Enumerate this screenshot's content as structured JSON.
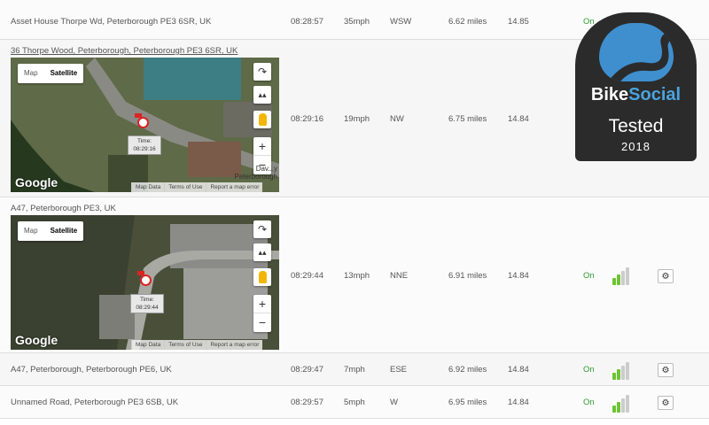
{
  "rows": [
    {
      "address": "Asset House Thorpe Wd, Peterborough PE3 6SR, UK",
      "time": "08:28:57",
      "speed": "35mph",
      "direction": "WSW",
      "distance": "6.62 miles",
      "voltage": "14.85",
      "ignition": "On"
    },
    {
      "address": "36 Thorpe Wood, Peterborough, Peterborough PE3 6SR, UK",
      "time": "08:29:16",
      "speed": "19mph",
      "direction": "NW",
      "distance": "6.75 miles",
      "voltage": "14.84"
    },
    {
      "address": "A47, Peterborough PE3, UK",
      "time": "08:29:44",
      "speed": "13mph",
      "direction": "NNE",
      "distance": "6.91 miles",
      "voltage": "14.84",
      "ignition": "On",
      "signal_bars": 2
    },
    {
      "address": "A47, Peterborough, Peterborough PE6, UK",
      "time": "08:29:47",
      "speed": "7mph",
      "direction": "ESE",
      "distance": "6.92 miles",
      "voltage": "14.84",
      "ignition": "On",
      "signal_bars": 2
    },
    {
      "address": "Unnamed Road, Peterborough PE3 6SB, UK",
      "time": "08:29:57",
      "speed": "5mph",
      "direction": "W",
      "distance": "6.95 miles",
      "voltage": "14.84",
      "ignition": "On",
      "signal_bars": 2
    }
  ],
  "maps": [
    {
      "toggle_map": "Map",
      "toggle_satellite": "Satellite",
      "tip_label": "Time:",
      "tip_time": "08:29:16",
      "google": "Google",
      "attrib": [
        "Map Data",
        "Terms of Use",
        "Report a map error"
      ],
      "place_line1": "Dav...y",
      "place_line2": "Peterborough"
    },
    {
      "toggle_map": "Map",
      "toggle_satellite": "Satellite",
      "tip_label": "Time:",
      "tip_time": "08:29:44",
      "google": "Google",
      "attrib": [
        "Map Data",
        "Terms of Use",
        "Report a map error"
      ]
    }
  ],
  "badge": {
    "brand_a": "Bike",
    "brand_b": "Social",
    "tested": "Tested",
    "year": "2018"
  },
  "icons": {
    "gear": "gear-icon",
    "signal": "signal-strength-icon",
    "rotate": "rotate-map-icon",
    "tilt": "tilt-icon",
    "pegman": "street-view-icon"
  },
  "colors": {
    "ignition_on": "#2f9a2f",
    "signal_active": "#6cc531",
    "badge_bg": "#2b2b2b",
    "badge_accent": "#3f8fce"
  }
}
